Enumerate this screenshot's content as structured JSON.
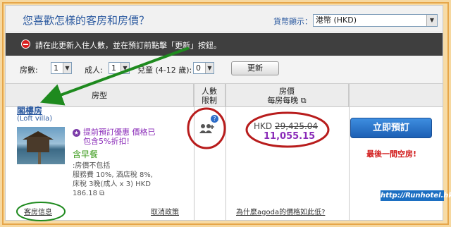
{
  "header": {
    "title": "您喜歡怎樣的客房和房價？",
    "currency_label": "貨幣顯示：",
    "currency_value": "港幣 (HKD)"
  },
  "warning": {
    "text": "請在此更新入住人數，並在預訂前點擊「更新」按鈕。"
  },
  "controls": {
    "rooms_label": "房數:",
    "rooms_value": "1",
    "adults_label": "成人:",
    "adults_value": "1",
    "children_label": "兒童 (4-12 歲):",
    "children_value": "0",
    "update_label": "更新"
  },
  "table": {
    "col_room": "房型",
    "col_occupancy_1": "人數",
    "col_occupancy_2": "限制",
    "col_price_1": "房價",
    "col_price_2": "每房每晚 ⧉"
  },
  "room": {
    "name": "閣樓房",
    "name_en": "(Loft villa)",
    "promo": "提前預訂優惠 價格已包含5%折扣!",
    "breakfast": "含早餐",
    "tax_line1": ":房價不包括",
    "tax_line2": "服務費 10%, 酒店稅 8%,",
    "tax_line3": "床稅 3晚(成人 x 3) HKD",
    "tax_line4": "186.18 ⧉",
    "info_link": "客房信息",
    "cancel_link": "取消政策"
  },
  "price": {
    "currency": "HKD",
    "original": "29,425.04",
    "final": "11,055.15",
    "why_link": "為什麼agoda的價格如此低?"
  },
  "booking": {
    "button": "立即預訂",
    "last_room": "最後一間空房!"
  },
  "watermark": "http://Runhotel.hk",
  "colors": {
    "accent_blue": "#2c5aa0",
    "promo_purple": "#8a2bb8",
    "breakfast_green": "#3a9a1a",
    "alert_red": "#d21c1c",
    "annotation_green": "#1e8a1e",
    "annotation_red": "#b81c1c"
  }
}
